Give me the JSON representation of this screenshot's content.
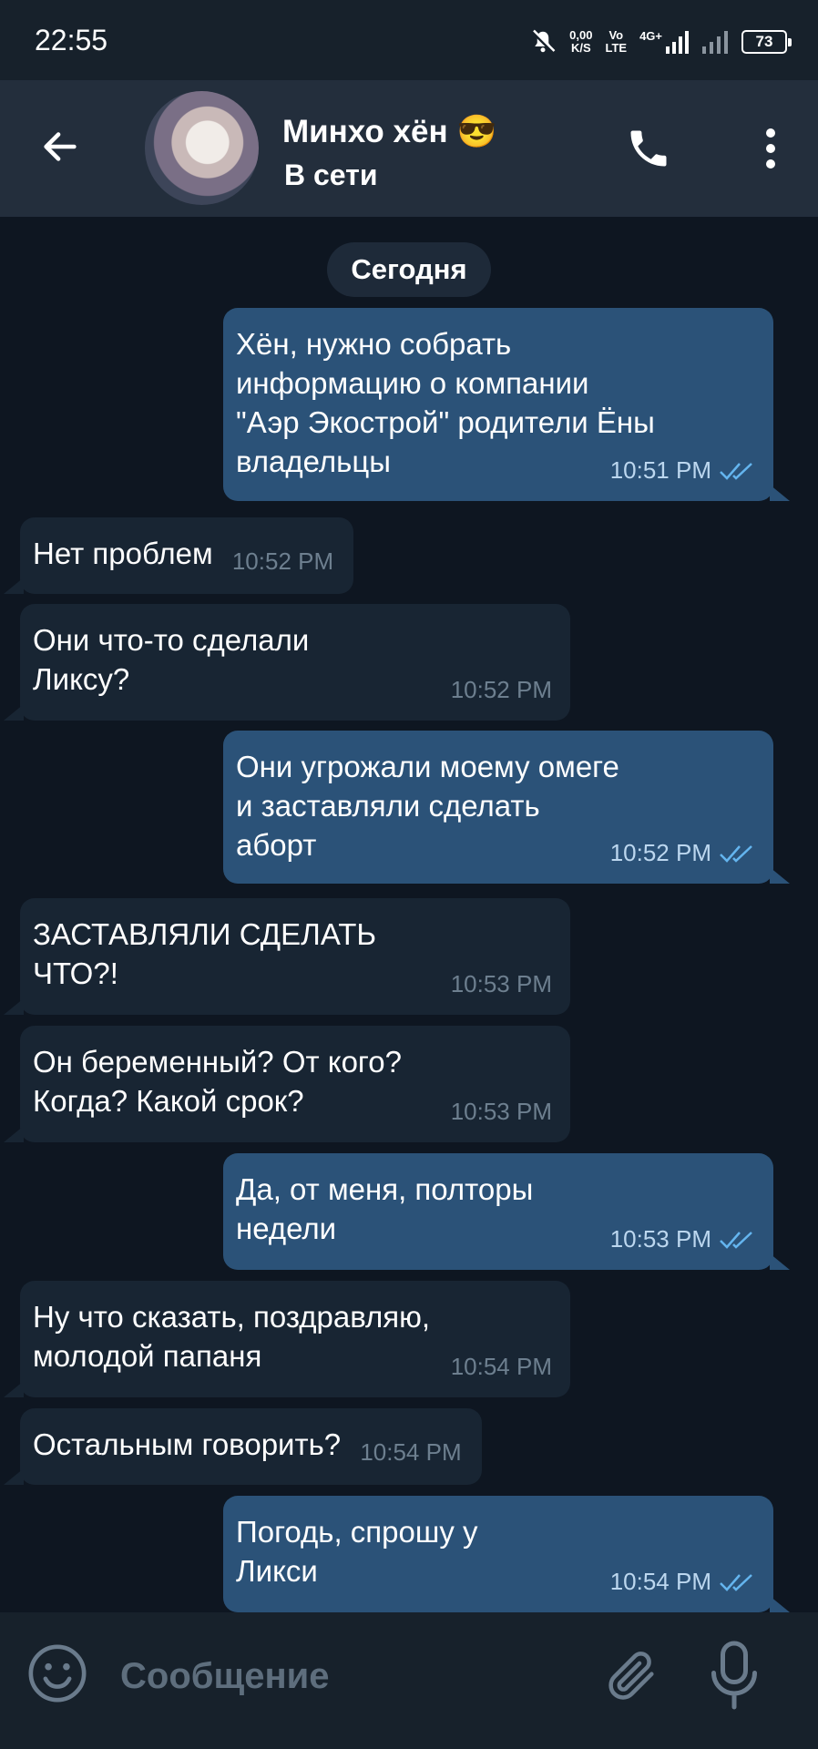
{
  "status_bar": {
    "time": "22:55",
    "net_speed_value": "0,00",
    "net_speed_unit": "K/S",
    "volte_top": "Vo",
    "volte_bottom": "LTE",
    "network_type": "4G+",
    "battery": "73"
  },
  "header": {
    "contact_name": "Минхо хён",
    "contact_emoji": "😎",
    "status": "В сети"
  },
  "chat": {
    "date_label": "Сегодня",
    "messages": [
      {
        "direction": "out",
        "text": "Хён, нужно собрать\nинформацию о компании\n\"Аэр Экострой\" родители Ёны\nвладельцы",
        "time": "10:51 PM",
        "read": true
      },
      {
        "direction": "in",
        "text": "Нет проблем",
        "time": "10:52 PM"
      },
      {
        "direction": "in",
        "text": "Они что-то сделали\nЛиксу?",
        "time": "10:52 PM"
      },
      {
        "direction": "out",
        "text": "Они угрожали моему омеге\nи заставляли сделать\nаборт",
        "time": "10:52 PM",
        "read": true
      },
      {
        "direction": "in",
        "text": "ЗАСТАВЛЯЛИ СДЕЛАТЬ\nЧТО?!",
        "time": "10:53 PM"
      },
      {
        "direction": "in",
        "text": "Он беременный? От кого?\nКогда? Какой срок?",
        "time": "10:53 PM"
      },
      {
        "direction": "out",
        "text": "Да, от меня, полторы\nнедели",
        "time": "10:53 PM",
        "read": true
      },
      {
        "direction": "in",
        "text": "Ну что сказать, поздравляю,\nмолодой папаня",
        "time": "10:54 PM"
      },
      {
        "direction": "in",
        "text": "Остальным говорить?",
        "time": "10:54 PM"
      },
      {
        "direction": "out",
        "text": "Погодь, спрошу у\nЛикси",
        "time": "10:54 PM",
        "read": true
      }
    ]
  },
  "composer": {
    "placeholder": "Сообщение"
  },
  "icons": {
    "back": "arrow-left-icon",
    "call": "phone-icon",
    "menu": "more-vertical-icon",
    "emoji": "smile-icon",
    "attach": "paperclip-icon",
    "mic": "microphone-icon",
    "read_receipt": "double-check-icon"
  },
  "colors": {
    "header_bg": "#232e3c",
    "chat_bg": "#0e1621",
    "incoming_bubble": "#182533",
    "outgoing_bubble": "#2b5278",
    "read_check": "#64b5ef"
  }
}
